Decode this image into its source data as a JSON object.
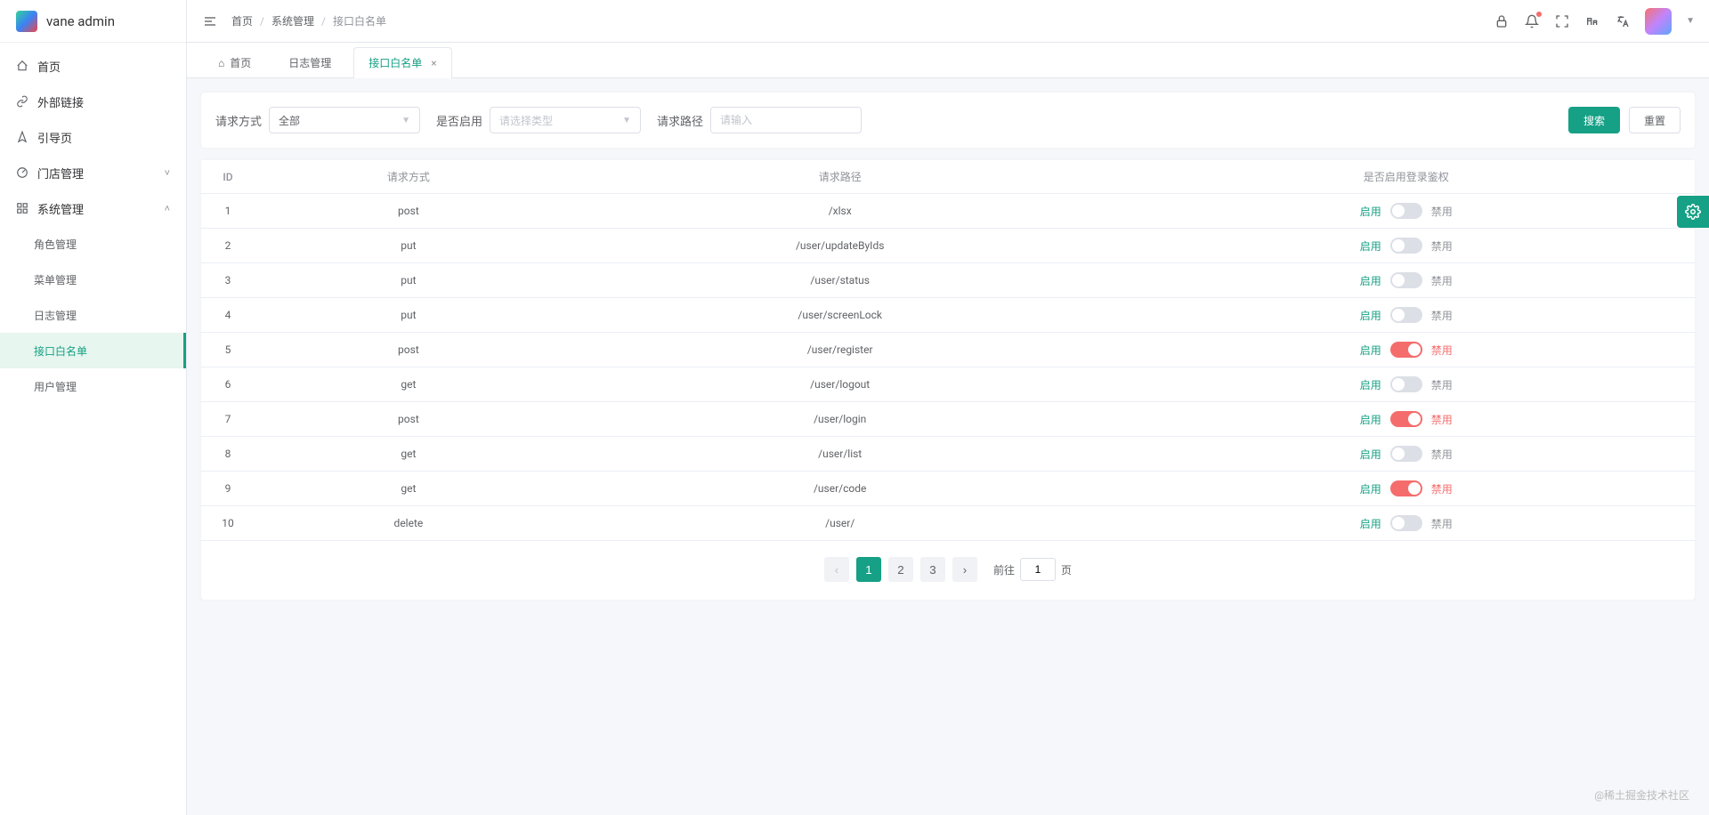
{
  "app": {
    "title": "vane admin"
  },
  "sidebar": {
    "items": [
      {
        "label": "首页",
        "icon": "home"
      },
      {
        "label": "外部链接",
        "icon": "link"
      },
      {
        "label": "引导页",
        "icon": "compass"
      },
      {
        "label": "门店管理",
        "icon": "dashboard",
        "expandable": true,
        "expanded": false
      },
      {
        "label": "系统管理",
        "icon": "grid",
        "expandable": true,
        "expanded": true,
        "children": [
          {
            "label": "角色管理"
          },
          {
            "label": "菜单管理"
          },
          {
            "label": "日志管理"
          },
          {
            "label": "接口白名单",
            "active": true
          },
          {
            "label": "用户管理"
          }
        ]
      }
    ]
  },
  "breadcrumb": {
    "items": [
      "首页",
      "系统管理",
      "接口白名单"
    ]
  },
  "tabs": [
    {
      "label": "首页",
      "home": true
    },
    {
      "label": "日志管理"
    },
    {
      "label": "接口白名单",
      "active": true,
      "closable": true
    }
  ],
  "filters": {
    "method_label": "请求方式",
    "method_value": "全部",
    "enable_label": "是否启用",
    "enable_placeholder": "请选择类型",
    "path_label": "请求路径",
    "path_placeholder": "请输入",
    "search_btn": "搜索",
    "reset_btn": "重置"
  },
  "table": {
    "columns": [
      "ID",
      "请求方式",
      "请求路径",
      "是否启用登录鉴权"
    ],
    "toggle_labels": {
      "on": "启用",
      "off": "禁用"
    },
    "rows": [
      {
        "id": "1",
        "method": "post",
        "path": "/xlsx",
        "enabled": false
      },
      {
        "id": "2",
        "method": "put",
        "path": "/user/updateByIds",
        "enabled": false
      },
      {
        "id": "3",
        "method": "put",
        "path": "/user/status",
        "enabled": false
      },
      {
        "id": "4",
        "method": "put",
        "path": "/user/screenLock",
        "enabled": false
      },
      {
        "id": "5",
        "method": "post",
        "path": "/user/register",
        "enabled": true
      },
      {
        "id": "6",
        "method": "get",
        "path": "/user/logout",
        "enabled": false
      },
      {
        "id": "7",
        "method": "post",
        "path": "/user/login",
        "enabled": true
      },
      {
        "id": "8",
        "method": "get",
        "path": "/user/list",
        "enabled": false
      },
      {
        "id": "9",
        "method": "get",
        "path": "/user/code",
        "enabled": true
      },
      {
        "id": "10",
        "method": "delete",
        "path": "/user/",
        "enabled": false
      }
    ]
  },
  "pagination": {
    "pages": [
      "1",
      "2",
      "3"
    ],
    "current": 1,
    "jump_prefix": "前往",
    "jump_value": "1",
    "jump_suffix": "页"
  },
  "watermark": "@稀土掘金技术社区"
}
